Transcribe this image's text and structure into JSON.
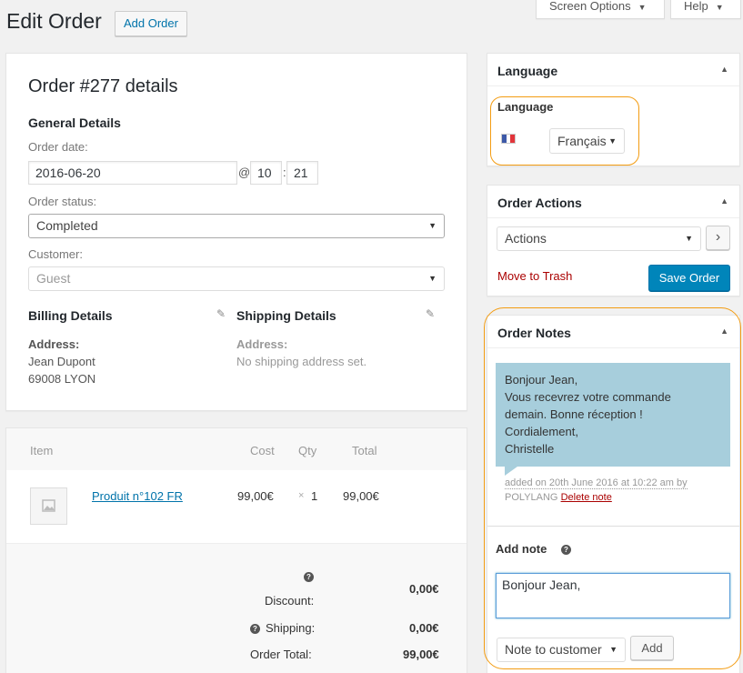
{
  "header": {
    "title": "Edit Order",
    "add_order": "Add Order",
    "screen_options": "Screen Options",
    "help": "Help"
  },
  "order": {
    "title": "Order #277 details",
    "general_details": "General Details",
    "order_date_label": "Order date:",
    "order_date": "2016-06-20",
    "at": "@",
    "hour": "10",
    "colon": ":",
    "minute": "21",
    "status_label": "Order status:",
    "status_value": "Completed",
    "customer_label": "Customer:",
    "customer_value": "Guest",
    "billing": {
      "title": "Billing Details",
      "address_label": "Address:",
      "address_line1": "Jean Dupont",
      "address_line2": "69008 LYON"
    },
    "shipping": {
      "title": "Shipping Details",
      "address_label": "Address:",
      "address_value": "No shipping address set."
    }
  },
  "items": {
    "headers": {
      "item": "Item",
      "cost": "Cost",
      "qty": "Qty",
      "total": "Total"
    },
    "rows": [
      {
        "name": "Produit n°102 FR",
        "cost": "99,00€",
        "qty_x": "×",
        "qty": "1",
        "total": "99,00€"
      }
    ],
    "totals": {
      "discount_label": "Discount:",
      "discount_value": "0,00€",
      "shipping_label": "Shipping:",
      "shipping_value": "0,00€",
      "order_total_label": "Order Total:",
      "order_total_value": "99,00€"
    }
  },
  "language_box": {
    "title": "Language",
    "label": "Language",
    "selected": "Français"
  },
  "order_actions": {
    "title": "Order Actions",
    "select_value": "Actions",
    "go": "›",
    "trash": "Move to Trash",
    "save": "Save Order"
  },
  "order_notes": {
    "title": "Order Notes",
    "note_lines": [
      "Bonjour Jean,",
      "Vous recevrez votre commande",
      "demain. Bonne réception !",
      "Cordialement,",
      "Christelle"
    ],
    "meta_added": "added on 20th June 2016 at 10:22 am by",
    "meta_author": "POLYLANG",
    "delete_note": "Delete note",
    "add_note_label": "Add note",
    "textarea_value": "Bonjour Jean,",
    "note_type": "Note to customer",
    "add_button": "Add"
  },
  "icons": {
    "help": "?",
    "edit": "✎",
    "caret_down": "▼",
    "caret_up": "▲"
  },
  "colors": {
    "accent": "#0073aa",
    "primary_button": "#0085ba",
    "highlight": "#f39c12",
    "note_bg": "#a7cedc",
    "danger": "#aa0000"
  }
}
